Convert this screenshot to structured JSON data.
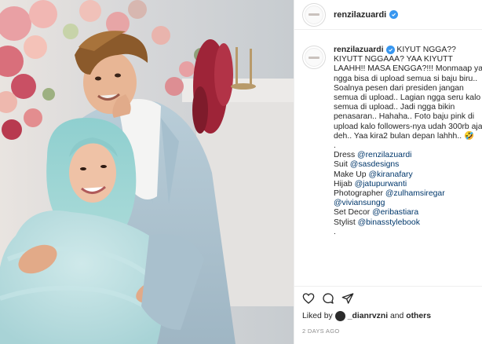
{
  "post": {
    "username": "renzilazuardi",
    "avatar_text": "",
    "caption": {
      "username": "renzilazuardi",
      "lines": [
        {
          "text": " KIYUT NGGA?? KIYUTT NGGAAA? YAA KIYUTT LAAHH!! MASA ENGGA?!!! Monmaap ya ngga bisa di upload semua si baju biru.. Soalnya pesen dari presiden jangan semua di upload.. Lagian ngga seru kalo semua di upload.. Jadi ngga bikin penasaran.. Hahaha.. Foto baju pink di upload kalo followers-nya udah 300rb aja deh.. Yaa kira2 bulan depan lahhh.. 🤣",
          "type": "text"
        }
      ],
      "dot1": ".",
      "credits": [
        {
          "label": "Dress ",
          "mention": "@renzilazuardi"
        },
        {
          "label": "Suit ",
          "mention": "@sasdesigns"
        },
        {
          "label": "Make Up ",
          "mention": "@kiranafary"
        },
        {
          "label": "Hijab ",
          "mention": "@jatupurwanti"
        },
        {
          "label": "Photographer ",
          "mention": "@zulhamsiregar"
        },
        {
          "label": "",
          "mention": "@viviansungg"
        },
        {
          "label": "Set Decor ",
          "mention": "@eribastiara"
        },
        {
          "label": "Stylist ",
          "mention": "@binasstylebook"
        }
      ],
      "dot2": "."
    },
    "likes": {
      "prefix": "Liked by ",
      "liker": "_dianrvzni",
      "middle": " and ",
      "others": "others"
    },
    "timestamp": "2 DAYS AGO"
  },
  "icons": {
    "like": "heart-icon",
    "comment": "comment-icon",
    "share": "share-icon",
    "verified": "verified-badge-icon"
  },
  "colors": {
    "verified": "#3897f0",
    "mention": "#00376b",
    "text": "#262626",
    "muted": "#8e8e8e"
  }
}
